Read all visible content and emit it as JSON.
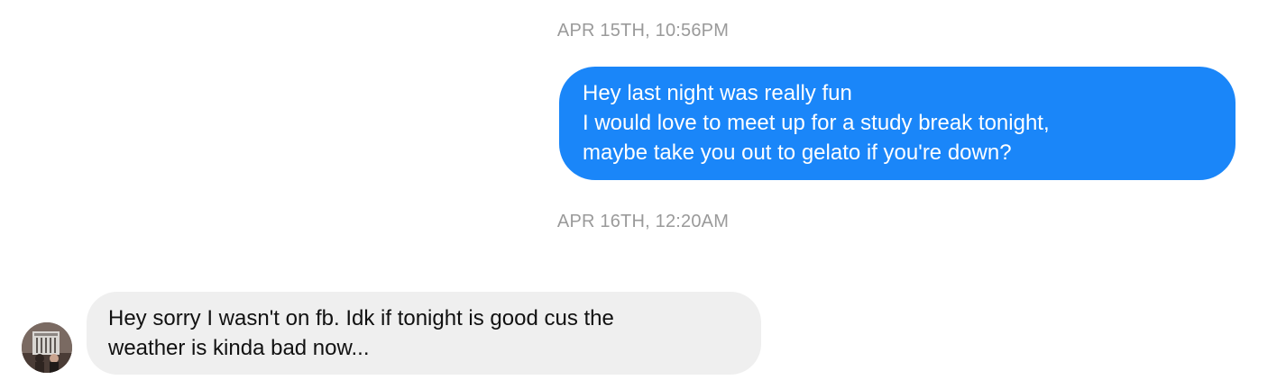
{
  "conversation": {
    "timestamps": [
      "APR 15TH, 10:56PM",
      "APR 16TH, 12:20AM"
    ],
    "messages": [
      {
        "direction": "outgoing",
        "lines": [
          "Hey last night was really fun",
          "I would love to meet up for a study break tonight,",
          "maybe take you out to gelato if you're down?"
        ]
      },
      {
        "direction": "incoming",
        "lines": [
          "Hey sorry I wasn't on fb. Idk if tonight is good cus the",
          "weather is kinda bad now..."
        ]
      }
    ]
  },
  "colors": {
    "outgoing_bubble": "#1a86f9",
    "incoming_bubble": "#efefef",
    "timestamp_text": "#9a9a9a"
  },
  "icons": {
    "contact_avatar": "avatar-photo-icon"
  }
}
